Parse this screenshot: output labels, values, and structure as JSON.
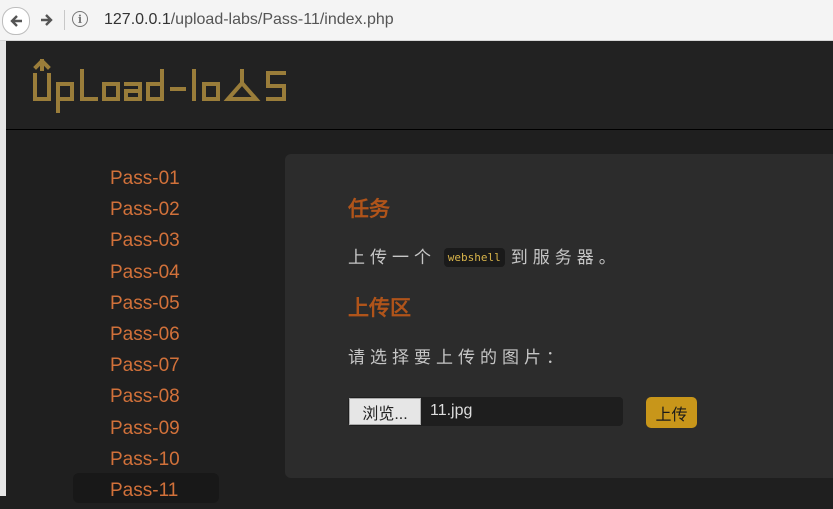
{
  "browser": {
    "url_host": "127.0.0.1",
    "url_path": "/upload-labs/Pass-11/index.php"
  },
  "header": {
    "logo_text": "Upload-labs",
    "logo_color": "#9a7d3a"
  },
  "sidebar": {
    "items": [
      "Pass-01",
      "Pass-02",
      "Pass-03",
      "Pass-04",
      "Pass-05",
      "Pass-06",
      "Pass-07",
      "Pass-08",
      "Pass-09",
      "Pass-10",
      "Pass-11"
    ],
    "active_item": "Pass-11",
    "link_color": "#d2713a"
  },
  "main": {
    "task_title": "任务",
    "task_text_before": "上传一个",
    "task_code": "webshell",
    "task_text_after": "到服务器。",
    "upload_title": "上传区",
    "choose_label": "请选择要上传的图片：",
    "browse_label": "浏览...",
    "selected_file": "11.jpg",
    "upload_label": "上传",
    "accent_color": "#b0541a",
    "button_color": "#c8961a"
  }
}
